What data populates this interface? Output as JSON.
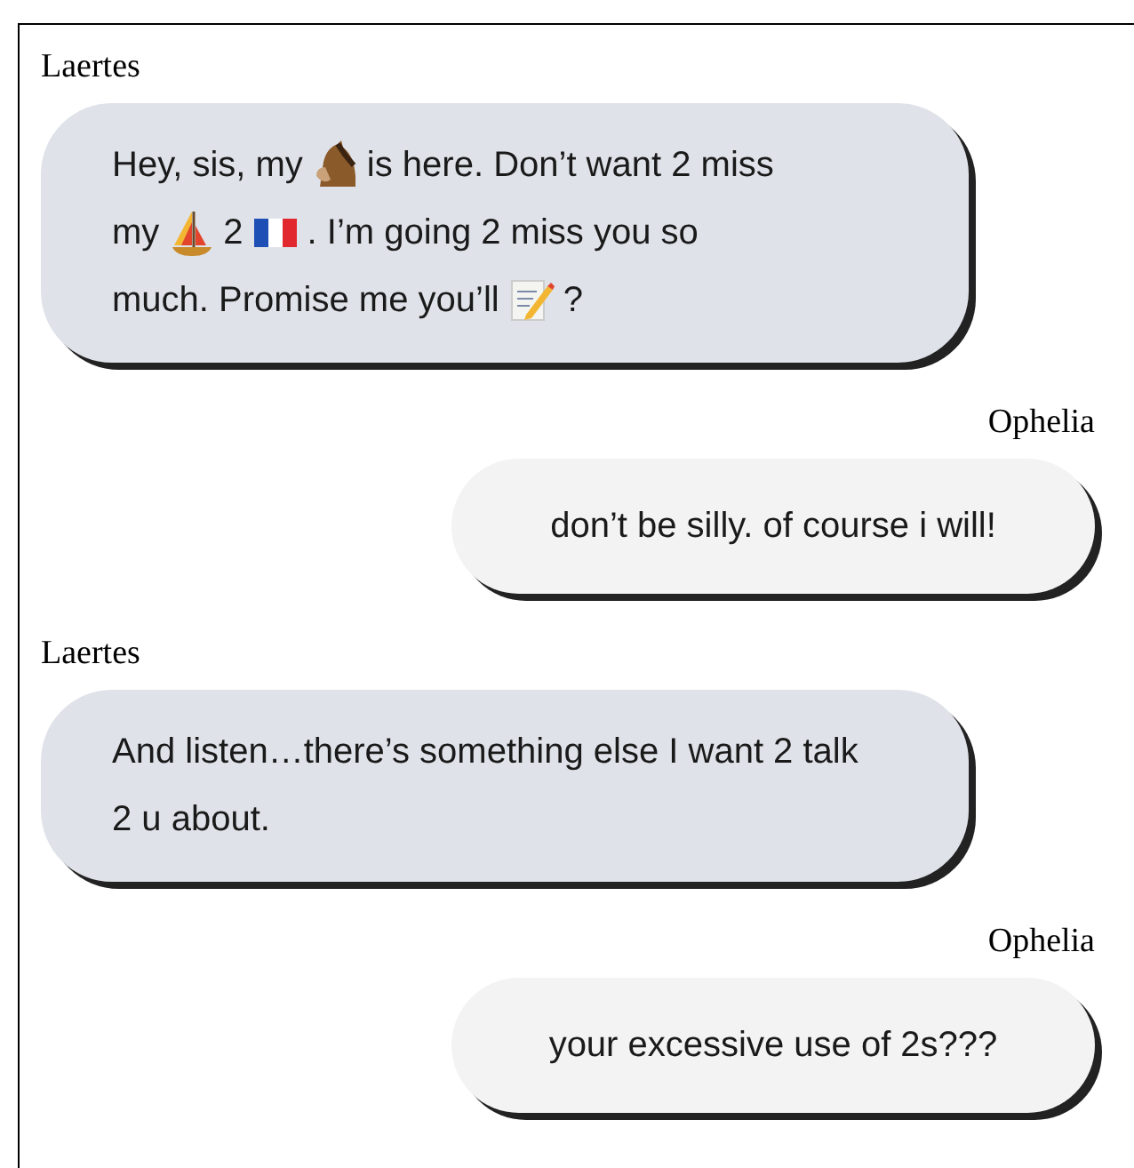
{
  "messages": [
    {
      "sender": "Laertes",
      "kind": "incoming",
      "parts": [
        {
          "kind": "text",
          "text": "Hey, sis, my"
        },
        {
          "kind": "horse"
        },
        {
          "kind": "text",
          "text": "is here. Don’t want 2 miss"
        },
        {
          "kind": "text",
          "text": "my"
        },
        {
          "kind": "sailboat"
        },
        {
          "kind": "text",
          "text": "2"
        },
        {
          "kind": "flag"
        },
        {
          "kind": "text",
          "text": ". I’m going 2 miss you so"
        },
        {
          "kind": "text",
          "text": "much. Promise me you’ll"
        },
        {
          "kind": "memo"
        },
        {
          "kind": "text",
          "text": "?"
        }
      ]
    },
    {
      "sender": "Ophelia",
      "kind": "outgoing",
      "text": "don’t be silly. of course i will!"
    },
    {
      "sender": "Laertes",
      "kind": "incoming",
      "text": "And listen…there’s something else I want 2 talk 2 u about."
    },
    {
      "sender": "Ophelia",
      "kind": "outgoing",
      "text": "your excessive use of 2s???"
    }
  ]
}
